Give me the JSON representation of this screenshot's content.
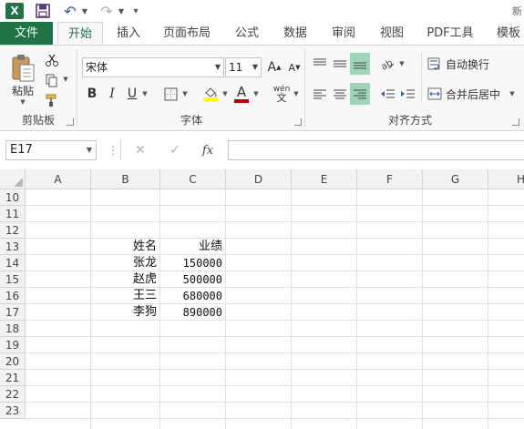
{
  "quick_access": {
    "logo": "X",
    "title_fragment": "新"
  },
  "tabs": [
    "文件",
    "开始",
    "插入",
    "页面布局",
    "公式",
    "数据",
    "审阅",
    "视图",
    "PDF工具",
    "模板"
  ],
  "ribbon": {
    "clipboard": {
      "paste_label": "粘贴",
      "group_label": "剪贴板"
    },
    "font": {
      "font_name": "宋体",
      "font_size": "11",
      "bold": "B",
      "italic": "I",
      "underline": "U",
      "phonetic": "wén",
      "group_label": "字体",
      "highlight_color": "#ffff00",
      "font_color": "#c00000"
    },
    "alignment": {
      "wrap_text": "自动换行",
      "merge_center": "合并后居中",
      "group_label": "对齐方式"
    }
  },
  "formula_bar": {
    "name_box": "E17",
    "fx": "fx",
    "formula": ""
  },
  "sheet": {
    "columns": [
      "A",
      "B",
      "C",
      "D",
      "E",
      "F",
      "G",
      "H"
    ],
    "rows": [
      "10",
      "11",
      "12",
      "13",
      "14",
      "15",
      "16",
      "17",
      "18",
      "19",
      "20",
      "21",
      "22",
      "23"
    ],
    "table": {
      "header": {
        "name": "姓名",
        "score": "业绩"
      },
      "rows": [
        {
          "name": "张龙",
          "score": "150000"
        },
        {
          "name": "赵虎",
          "score": "500000"
        },
        {
          "name": "王三",
          "score": "680000"
        },
        {
          "name": "李狗",
          "score": "890000"
        }
      ]
    }
  },
  "colors": {
    "brand": "#217346",
    "align_highlight": "#9fd5b7"
  }
}
